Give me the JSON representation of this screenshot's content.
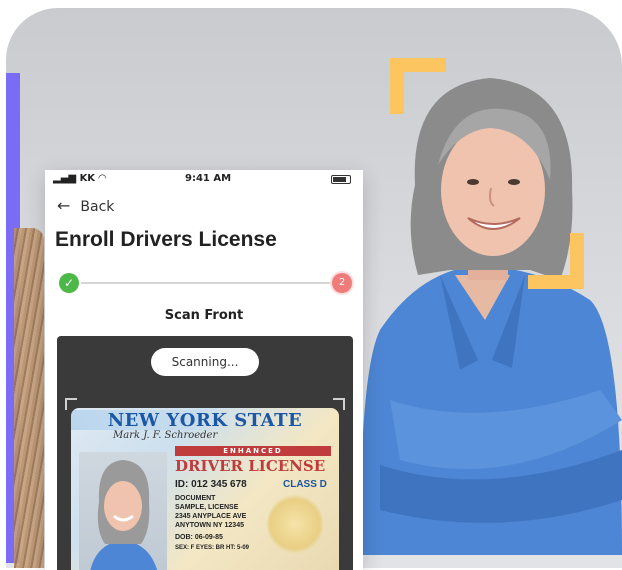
{
  "status_bar": {
    "carrier": "KK",
    "time": "9:41 AM"
  },
  "nav": {
    "back_label": "Back"
  },
  "page": {
    "title": "Enroll Drivers License"
  },
  "progress": {
    "step_current_number": "2",
    "step_done_mark": "✓"
  },
  "scan": {
    "section_label": "Scan Front",
    "status_pill": "Scanning..."
  },
  "license": {
    "state": "NEW YORK STATE",
    "enhanced_banner": "ENHANCED",
    "doc_type": "DRIVER LICENSE",
    "id_line": "ID: 012 345 678",
    "class_line": "CLASS D",
    "lines": [
      "DOCUMENT",
      "SAMPLE, LICENSE",
      "2345 ANYPLACE AVE",
      "ANYTOWN NY  12345",
      "DOB: 06-09-85",
      "SEX: F   EYES: BR   HT: 5-09"
    ]
  },
  "colors": {
    "accent_yellow": "#fcc55f",
    "purple_edge": "#7b6cf6",
    "step_done": "#4cb847",
    "step_next": "#f07b7b"
  }
}
